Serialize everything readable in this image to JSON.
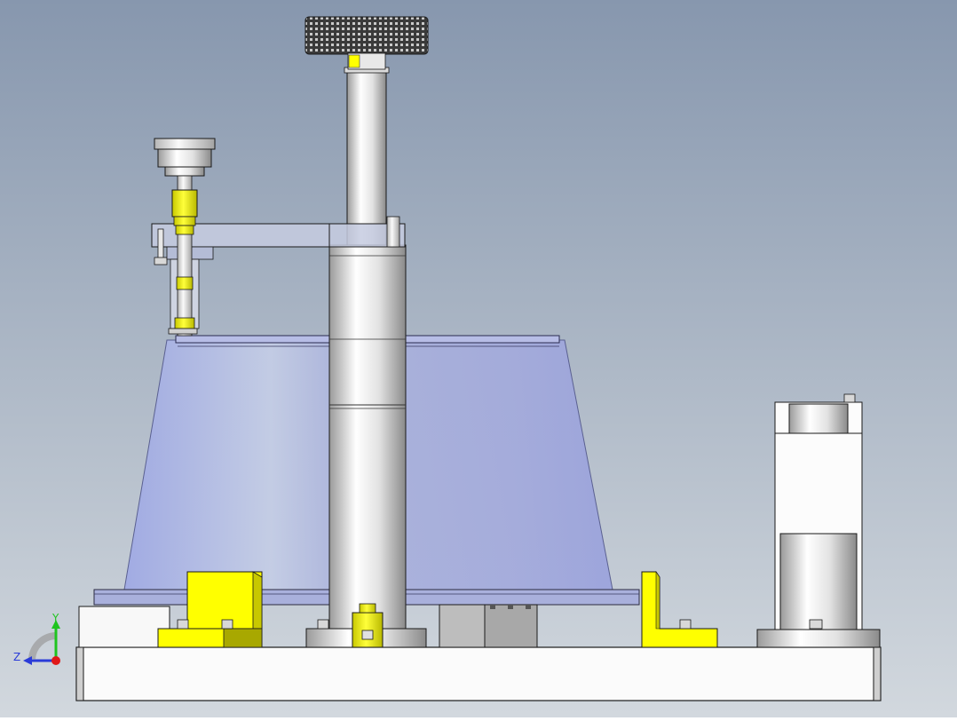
{
  "viewport": {
    "background": {
      "top": "#8797ae",
      "bottom": "#d2d8de"
    },
    "colors": {
      "metal_light": "#f4f4f4",
      "metal_dark": "#8c8c8c",
      "yellow": "#ffff00",
      "yellow_shade": "#c8c800",
      "translucent_blue": "#9aa6e6",
      "edge": "#1a1a1a"
    }
  },
  "triad": {
    "y_label": "Y",
    "z_label": "Z",
    "y_color": "#1fc41f",
    "z_color": "#2a3bd8",
    "x_color": "#e01818"
  }
}
